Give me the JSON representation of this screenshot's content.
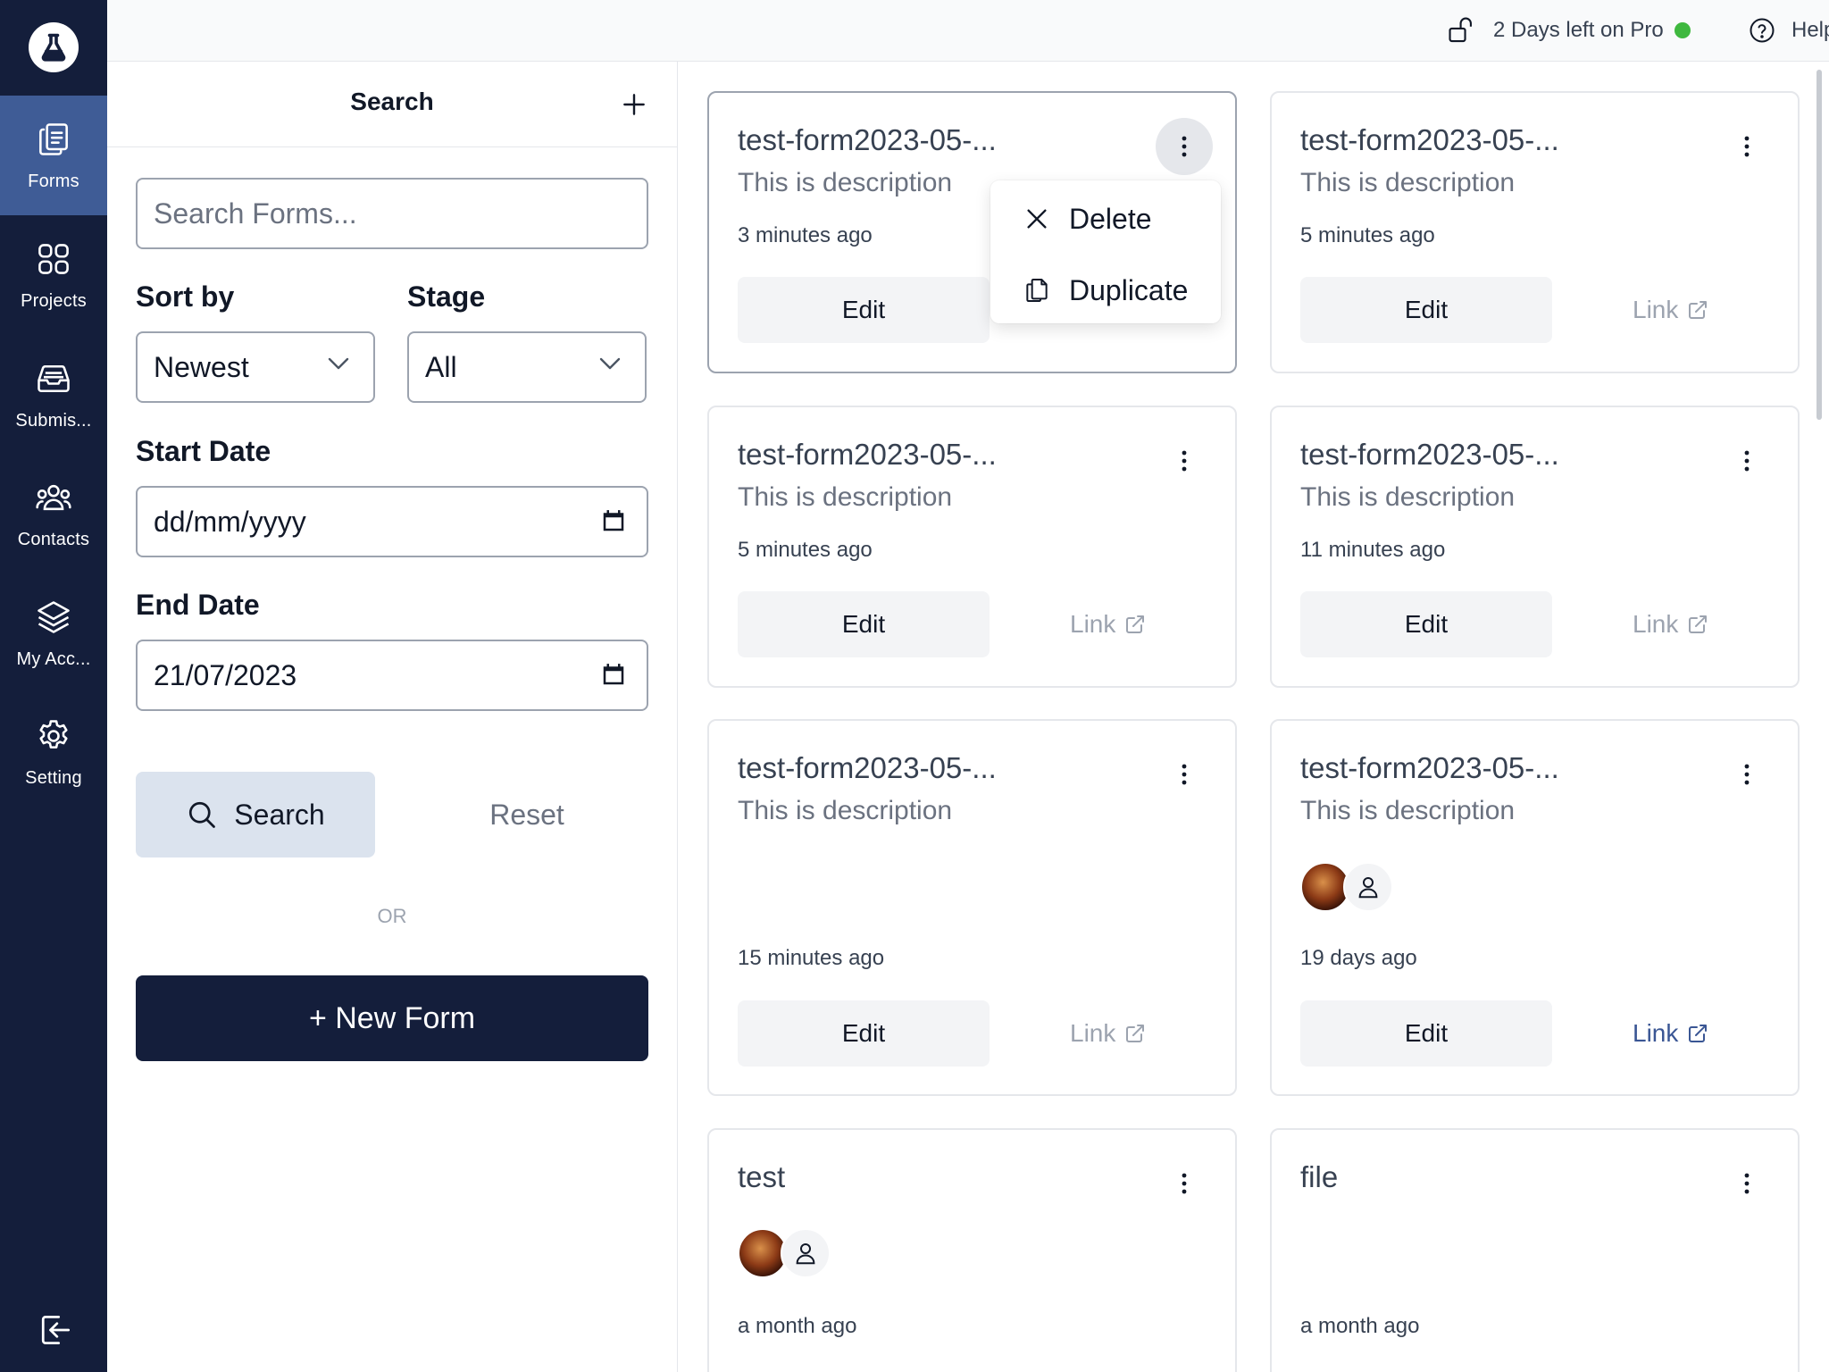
{
  "nav": {
    "items": [
      {
        "label": "Forms",
        "icon": "clipboard-icon",
        "active": true
      },
      {
        "label": "Projects",
        "icon": "grid-icon"
      },
      {
        "label": "Submis...",
        "icon": "inbox-icon"
      },
      {
        "label": "Contacts",
        "icon": "users-icon"
      },
      {
        "label": "My Acc...",
        "icon": "layers-icon"
      },
      {
        "label": "Setting",
        "icon": "gear-icon"
      }
    ]
  },
  "topbar": {
    "pro_label": "2 Days left on Pro",
    "pro_status_color": "#3fb83f",
    "help_label": "Help"
  },
  "filters": {
    "title": "Search",
    "search_placeholder": "Search Forms...",
    "sort_label": "Sort by",
    "sort_value": "Newest",
    "stage_label": "Stage",
    "stage_value": "All",
    "start_label": "Start Date",
    "start_value": "dd/mm/yyyy",
    "end_label": "End Date",
    "end_value": "21/07/2023",
    "search_button": "Search",
    "reset_button": "Reset",
    "or_text": "OR",
    "new_form_button": "+ New Form"
  },
  "dropdown": {
    "delete_label": "Delete",
    "duplicate_label": "Duplicate"
  },
  "cards": [
    {
      "title": "test-form2023-05-...",
      "description": "This is description",
      "time": "3 minutes ago",
      "edit": "Edit"
    },
    {
      "title": "test-form2023-05-...",
      "description": "This is description",
      "time": "5 minutes ago",
      "edit": "Edit",
      "link": "Link"
    },
    {
      "title": "test-form2023-05-...",
      "description": "This is description",
      "time": "5 minutes ago",
      "edit": "Edit",
      "link": "Link"
    },
    {
      "title": "test-form2023-05-...",
      "description": "This is description",
      "time": "11 minutes ago",
      "edit": "Edit",
      "link": "Link"
    },
    {
      "title": "test-form2023-05-...",
      "description": "This is description",
      "time": "15 minutes ago",
      "edit": "Edit",
      "link": "Link"
    },
    {
      "title": "test-form2023-05-...",
      "description": "This is description",
      "time": "19 days ago",
      "edit": "Edit",
      "link": "Link"
    },
    {
      "title": "test",
      "time": "a month ago"
    },
    {
      "title": "file",
      "time": "a month ago"
    }
  ],
  "colors": {
    "rail_bg": "#141e3b",
    "rail_active": "#3f5c96",
    "primary_button": "#141e3b",
    "link_active": "#3a5694"
  }
}
